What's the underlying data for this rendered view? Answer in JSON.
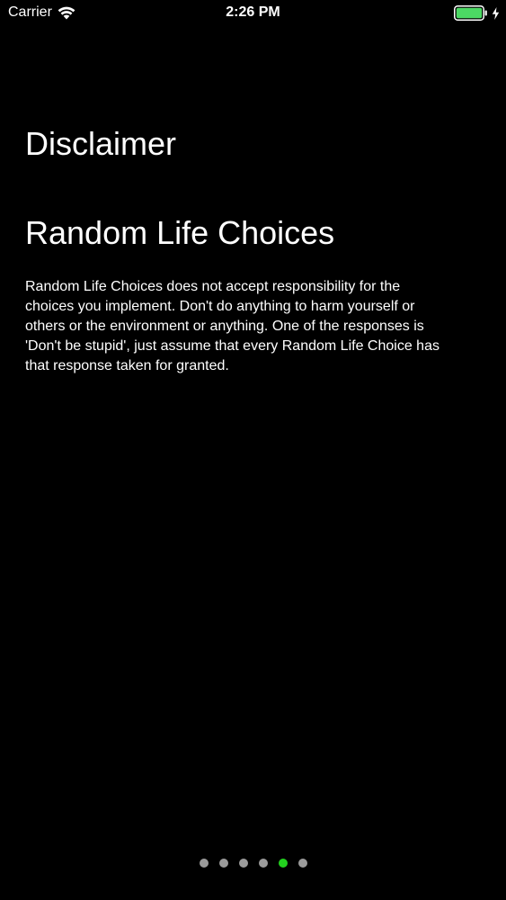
{
  "status_bar": {
    "carrier": "Carrier",
    "time": "2:26 PM",
    "icons": [
      "wifi-icon",
      "battery-icon",
      "charging-bolt-icon"
    ],
    "battery_color": "#4cd964"
  },
  "page": {
    "title": "Disclaimer",
    "app_name": "Random Life Choices",
    "body_lines": [
      "Random Life Choices does not accept responsibility for the",
      "choices you implement. Don't do anything to harm yourself or",
      "others or the environment or anything. One of the responses is",
      "'Don't be stupid', just assume that every Random Life Choice has",
      "that response taken for granted."
    ]
  },
  "page_indicator": {
    "page_count": 6,
    "current_page": 5,
    "active_color": "#23d11f",
    "inactive_color": "#9b9b9b"
  },
  "colors": {
    "background": "#000000",
    "text": "#ffffff"
  }
}
